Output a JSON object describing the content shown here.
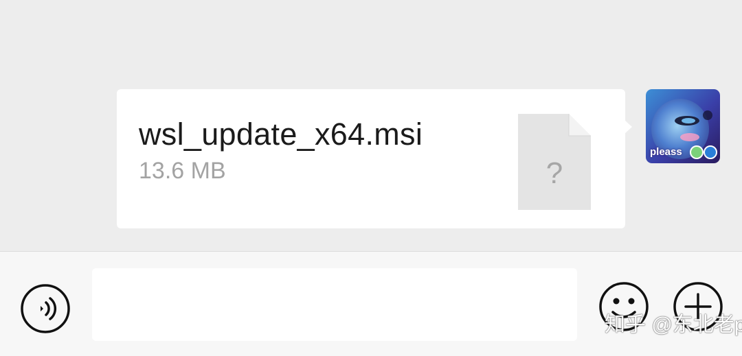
{
  "message": {
    "file_name": "wsl_update_x64.msi",
    "file_size": "13.6 MB",
    "file_icon": "unknown-file-icon",
    "file_icon_glyph": "?"
  },
  "avatar": {
    "label": "pleass"
  },
  "input_bar": {
    "voice_icon": "voice-icon",
    "input_value": "",
    "emoji_icon": "emoji-icon",
    "add_icon": "plus-icon"
  },
  "watermark": {
    "text": "知乎 @东北老p"
  },
  "colors": {
    "chat_background": "#ededed",
    "bubble": "#ffffff",
    "input_bar": "#f7f7f7",
    "icon_stroke": "#111111"
  }
}
